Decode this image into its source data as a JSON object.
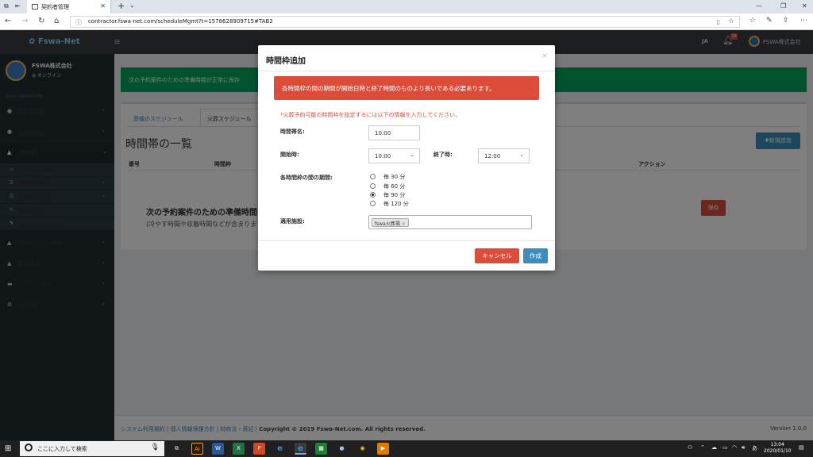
{
  "browser": {
    "tab_title": "契約者管理",
    "tab_close": "✕",
    "new_tab": "+",
    "tab_list": "⌄",
    "url": "contractor.fswa-net.com/scheduleMgmt?t=1578628909715#TAB2",
    "window_controls": [
      "—",
      "❐",
      "✕"
    ]
  },
  "header": {
    "logo": "✿ Fswa-Net",
    "menu_icon": "≡",
    "lang": "JA",
    "notification_count": "10",
    "user_name": "FSWA株式会社"
  },
  "sidebar": {
    "company": "FSWA株式会社",
    "status": "オンライン",
    "nav_head": "MAIN NAVIGATION",
    "items": [
      {
        "label": "霊柩車管理",
        "icon": "●"
      },
      {
        "label": "火葬所管理",
        "icon": "●"
      },
      {
        "label": "葬儀管理",
        "icon": "▲"
      },
      {
        "label": "宗教サービス管理",
        "icon": "▲"
      },
      {
        "label": "墓地管理",
        "icon": "▲"
      },
      {
        "label": "サービス予約",
        "icon": "▬"
      },
      {
        "label": "一般設定",
        "icon": "⚙"
      }
    ],
    "sub_items": [
      {
        "label": "予約案件管理",
        "icon": "▭"
      },
      {
        "label": "葬儀場管理",
        "icon": "☰"
      },
      {
        "label": "火葬場管理",
        "icon": "☰"
      },
      {
        "label": "価格管理",
        "icon": "✎"
      },
      {
        "label": "スケジュール管理",
        "icon": "✎"
      }
    ]
  },
  "main": {
    "alert_text": "次の予約案件のための準備時間が正常に保存",
    "tabs": [
      "葬儀のスケジュール",
      "火葬スケジュール"
    ],
    "list_title": "時間帯の一覧",
    "add_button": "✚新規追加",
    "columns": [
      "番号",
      "時間枠",
      "アクション"
    ],
    "row_title": "次の予約案件のための準備時間",
    "row_desc": "(冷やす時間や収着時間などが含まります",
    "save_button": "保存"
  },
  "footer": {
    "links": "システム利用規約 | 個人情報保護方針 | 特商法・表記 |",
    "copyright": "Copyright © 2019 Fswa-Net.com. All rights reserved.",
    "version": "Version 1.0.0"
  },
  "modal": {
    "title": "時間枠追加",
    "close": "×",
    "alert": "各時間枠の間の期間が開始日時と終了時間のものより長いである必要あります。",
    "hint": "*火葬予約可能の時間枠を設定するには以下の情報を入力してください。",
    "slot_name_label": "時間帯名:",
    "slot_name_value": "10:00",
    "start_label": "開始時:",
    "start_value": "10:00",
    "end_label": "終了時:",
    "end_value": "12:00",
    "interval_label": "各時間枠の間の期間:",
    "intervals": [
      {
        "label": "毎 30 分",
        "checked": false
      },
      {
        "label": "毎 60 分",
        "checked": false
      },
      {
        "label": "毎 90 分",
        "checked": true
      },
      {
        "label": "毎 120 分",
        "checked": false
      }
    ],
    "facility_label": "適用施設:",
    "facility_tag": "fswa火葬場",
    "facility_tag_remove": "×",
    "cancel_button": "キャンセル",
    "create_button": "作成"
  },
  "taskbar": {
    "search_placeholder": "ここに入力して検索",
    "apps": [
      "⧉",
      "Ai",
      "W",
      "X",
      "P",
      "e",
      "e",
      "▦",
      "●",
      "◉",
      "▶"
    ],
    "ime": "あ",
    "time": "13:04",
    "date": "2020/01/10"
  },
  "colors": {
    "danger": "#dd4b39",
    "primary": "#3c8dbc",
    "success": "#00a65a",
    "sidebar": "#222d32"
  }
}
